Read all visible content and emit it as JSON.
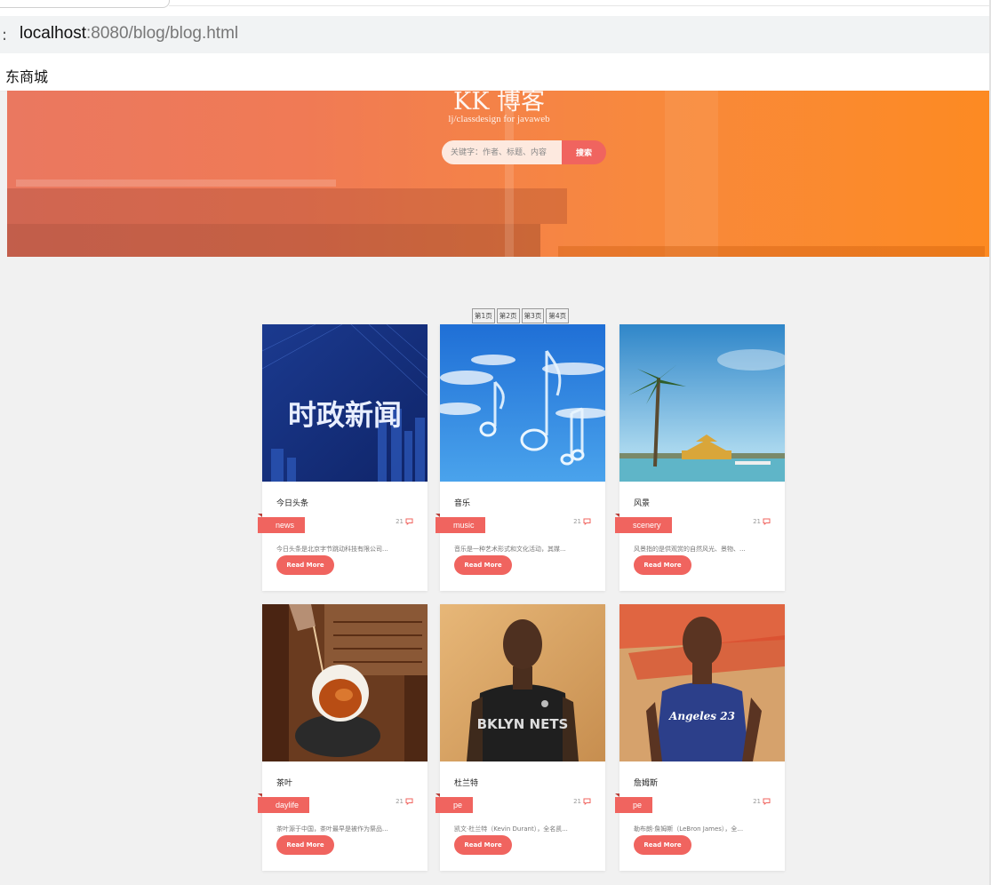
{
  "browser": {
    "url_host": "localhost",
    "url_rest": ":8080/blog/blog.html",
    "address_lead": ":",
    "bookmark": "东商城"
  },
  "hero": {
    "title": "KK 博客",
    "subtitle": "lj/classdesign for javaweb",
    "search_placeholder": "关键字：作者、标题、内容",
    "search_button": "搜索"
  },
  "pagination": [
    "第1页",
    "第2页",
    "第3页",
    "第4页"
  ],
  "posts": [
    {
      "title": "今日头条",
      "tag": "news",
      "count": "21",
      "excerpt": "今日头条是北京字节跳动科技有限公司...",
      "read_more": "Read More",
      "image_text": "时政新闻"
    },
    {
      "title": "音乐",
      "tag": "music",
      "count": "21",
      "excerpt": "音乐是一种艺术形式和文化活动，其媒...",
      "read_more": "Read More"
    },
    {
      "title": "风景",
      "tag": "scenery",
      "count": "21",
      "excerpt": "风景指的是供观赏的自然风光、景物、...",
      "read_more": "Read More"
    },
    {
      "title": "茶叶",
      "tag": "daylife",
      "count": "21",
      "excerpt": "茶叶源于中国，茶叶最早是被作为祭品...",
      "read_more": "Read More"
    },
    {
      "title": "杜兰特",
      "tag": "pe",
      "count": "21",
      "excerpt": "凯文·杜兰特（Kevin Durant），全名凯...",
      "read_more": "Read More",
      "image_text": "BKLYN NETS"
    },
    {
      "title": "詹姆斯",
      "tag": "pe",
      "count": "21",
      "excerpt": "勒布朗·詹姆斯（LeBron James），全...",
      "read_more": "Read More",
      "image_text": "Angeles 23"
    }
  ],
  "colors": {
    "accent": "#f0645f",
    "hero_left": "#ea7860",
    "hero_right": "#fd8a22",
    "page_bg": "#f1f1f1"
  }
}
